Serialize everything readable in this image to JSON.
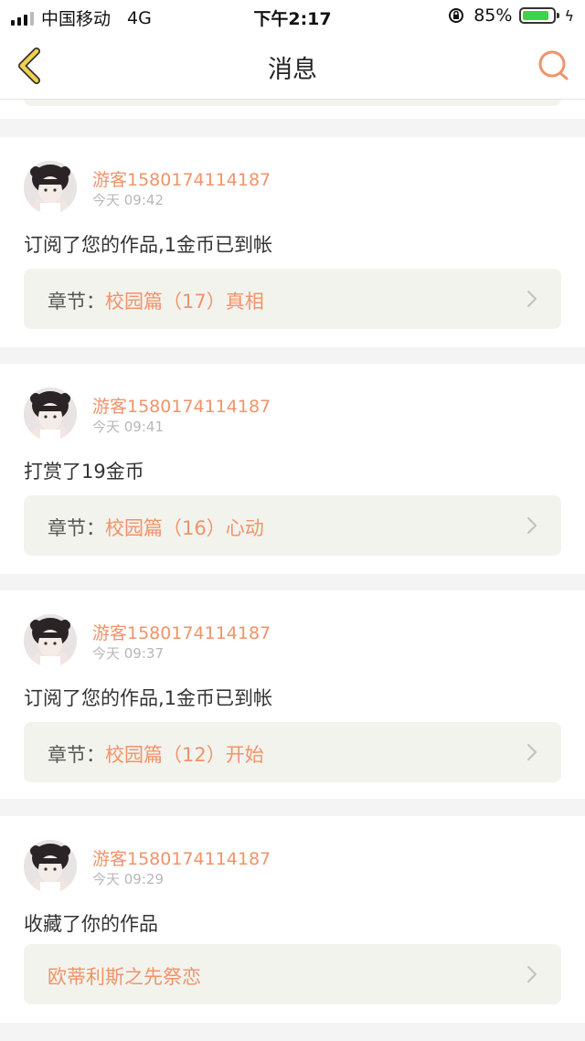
{
  "status_bar": {
    "carrier": "中国移动",
    "network": "4G",
    "time": "下午2:17",
    "battery": "85%",
    "battery_level": 0.85
  },
  "nav": {
    "title": "消息",
    "back_icon": "chevron-left-icon",
    "search_icon": "search-icon"
  },
  "colors": {
    "accent": "#f0936a",
    "back_arrow": "#f1d24e",
    "link_bg": "#f3f3ed",
    "page_bg": "#f4f4f4"
  },
  "messages": [
    {
      "user": "游客1580174114187",
      "time": "今天 09:42",
      "text": "订阅了您的作品,1金币已到帐",
      "link_prefix": "章节：",
      "link_title": "校园篇（17）真相"
    },
    {
      "user": "游客1580174114187",
      "time": "今天 09:41",
      "text": "打赏了19金币",
      "link_prefix": "章节：",
      "link_title": "校园篇（16）心动"
    },
    {
      "user": "游客1580174114187",
      "time": "今天 09:37",
      "text": "订阅了您的作品,1金币已到帐",
      "link_prefix": "章节：",
      "link_title": "校园篇（12）开始"
    },
    {
      "user": "游客1580174114187",
      "time": "今天 09:29",
      "text": "收藏了你的作品",
      "link_prefix": "",
      "link_title": "欧蒂利斯之先祭恋"
    }
  ]
}
